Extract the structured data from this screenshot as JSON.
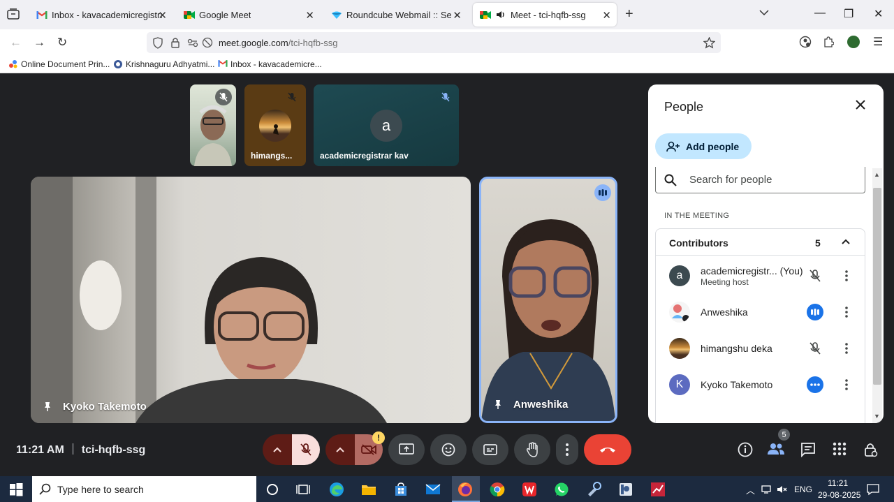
{
  "browser": {
    "tabs": [
      {
        "title": "Inbox - kavacademicregistrar@g",
        "icon": "gmail-icon"
      },
      {
        "title": "Google Meet",
        "icon": "meet-icon"
      },
      {
        "title": "Roundcube Webmail :: Search re",
        "icon": "roundcube-icon"
      },
      {
        "title": "Meet - tci-hqfb-ssg",
        "icon": "meet-icon",
        "active": true
      }
    ],
    "url_host": "meet.google.com",
    "url_path": "/tci-hqfb-ssg",
    "bookmarks": [
      {
        "label": "Online Document Prin...",
        "icon": "gdocs-icon"
      },
      {
        "label": "Krishnaguru Adhyatmi...",
        "icon": "site-icon"
      },
      {
        "label": "Inbox - kavacademicre...",
        "icon": "gmail-icon"
      }
    ]
  },
  "meet": {
    "thumbnails": [
      {
        "name": "",
        "kind": "video-man"
      },
      {
        "name": "himangs...",
        "kind": "avatar-sunset"
      },
      {
        "name": "academicregistrar kav",
        "kind": "letter",
        "letter": "a"
      }
    ],
    "main_tile": {
      "name": "Kyoko Takemoto"
    },
    "side_tile": {
      "name": "Anweshika"
    },
    "time": "11:21 AM",
    "meeting_code": "tci-hqfb-ssg",
    "warning_badge": "!",
    "people_count_badge": "5"
  },
  "people_panel": {
    "title": "People",
    "add_people_label": "Add people",
    "search_placeholder": "Search for people",
    "section_label": "IN THE MEETING",
    "group_title": "Contributors",
    "group_count": "5",
    "participants": [
      {
        "name": "academicregistr... (You)",
        "subtitle": "Meeting host",
        "avatar_letter": "a",
        "status": "mic-off"
      },
      {
        "name": "Anweshika",
        "subtitle": "",
        "avatar_letter": "",
        "status": "speaking"
      },
      {
        "name": "himangshu deka",
        "subtitle": "",
        "avatar_letter": "",
        "status": "mic-off"
      },
      {
        "name": "Kyoko Takemoto",
        "subtitle": "",
        "avatar_letter": "K",
        "status": "more-dots"
      }
    ]
  },
  "taskbar": {
    "search_placeholder": "Type here to search",
    "lang": "ENG",
    "time": "11:21",
    "date": "29-08-2025"
  },
  "colors": {
    "meet_bg": "#202124",
    "end_call": "#ea4335",
    "active_blue": "#1a73e8",
    "add_people_bg": "#c2e7ff"
  }
}
